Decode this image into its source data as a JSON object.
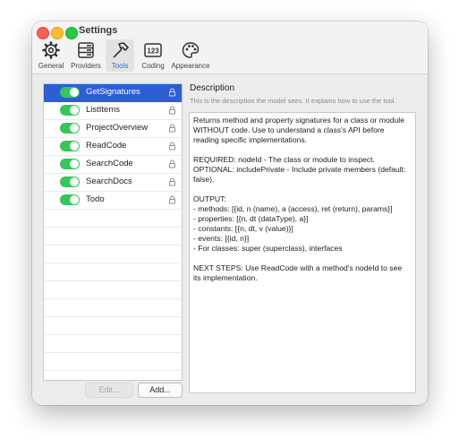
{
  "window": {
    "title": "Settings"
  },
  "tabs": [
    {
      "label": "General",
      "icon": "gear-icon"
    },
    {
      "label": "Providers",
      "icon": "server-icon"
    },
    {
      "label": "Tools",
      "icon": "hammer-icon",
      "active": true
    },
    {
      "label": "Coding",
      "icon": "numbers-icon"
    },
    {
      "label": "Appearance",
      "icon": "palette-icon"
    }
  ],
  "tools": [
    {
      "label": "GetSignatures",
      "enabled": true,
      "selected": true,
      "locked": true
    },
    {
      "label": "ListItems",
      "enabled": true,
      "locked": true
    },
    {
      "label": "ProjectOverview",
      "enabled": true,
      "locked": true
    },
    {
      "label": "ReadCode",
      "enabled": true,
      "locked": true
    },
    {
      "label": "SearchCode",
      "enabled": true,
      "locked": true
    },
    {
      "label": "SearchDocs",
      "enabled": true,
      "locked": true
    },
    {
      "label": "Todo",
      "enabled": true,
      "locked": true
    }
  ],
  "buttons": {
    "edit": "Edit...",
    "add": "Add..."
  },
  "description": {
    "heading": "Description",
    "subtitle": "This is the description the model sees. It explains how to use the tool.",
    "lines": [
      "Returns method and property signatures for a class or module WITHOUT code. Use to understand a class's API before reading specific implementations.",
      "",
      "REQUIRED: nodeId - The class or module to inspect.",
      "OPTIONAL: includePrivate - Include private members (default: false).",
      "",
      "OUTPUT:",
      "- methods: [{id, n (name), a (access), ret (return), params}]",
      "- properties: [{n, dt (dataType), a}]",
      "- constants: [{n, dt, v (value)}]",
      "- events: [{id, n}]",
      "- For classes: super (superclass), interfaces",
      "",
      "NEXT STEPS: Use ReadCode with a method's nodeId to see its implementation."
    ]
  },
  "colors": {
    "selection": "#2c5fd6",
    "toggle_on": "#34c759",
    "accent": "#1f6fe5"
  }
}
